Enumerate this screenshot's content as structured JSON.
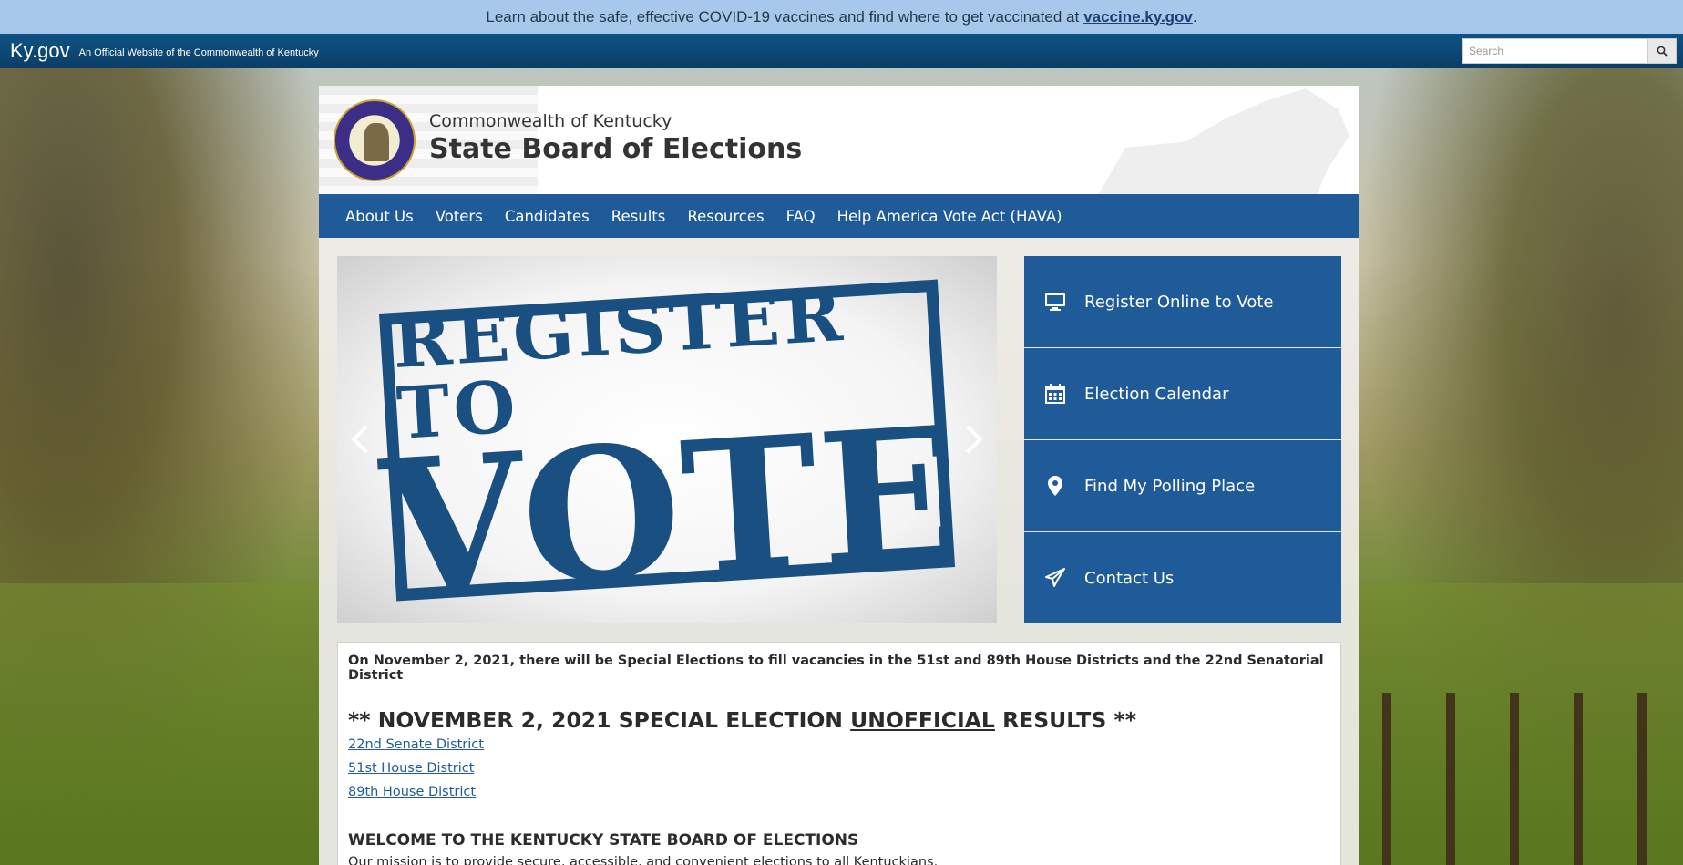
{
  "covid_banner": {
    "text": "Learn about the safe, effective COVID-19 vaccines and find where to get vaccinated at",
    "link": "vaccine.ky.gov",
    "end": "."
  },
  "kygov_bar": {
    "logo": "Ky.gov",
    "tagline": "An Official Website of the Commonwealth of Kentucky",
    "search_placeholder": "Search",
    "search_icon": "search-icon"
  },
  "header": {
    "subtitle": "Commonwealth of Kentucky",
    "title": "State Board of Elections"
  },
  "nav": {
    "items": [
      {
        "label": "About Us"
      },
      {
        "label": "Voters"
      },
      {
        "label": "Candidates"
      },
      {
        "label": "Results"
      },
      {
        "label": "Resources"
      },
      {
        "label": "FAQ"
      },
      {
        "label": "Help America Vote Act (HAVA)"
      }
    ]
  },
  "carousel": {
    "line1": "REGISTER TO",
    "line2": "VOTE"
  },
  "quick_links": [
    {
      "label": "Register Online to Vote",
      "icon": "monitor-icon"
    },
    {
      "label": "Election Calendar",
      "icon": "calendar-icon"
    },
    {
      "label": "Find My Polling Place",
      "icon": "map-pin-icon"
    },
    {
      "label": "Contact Us",
      "icon": "paper-plane-icon"
    }
  ],
  "main": {
    "announcement": "On November 2, 2021, there will be Special Elections to fill vacancies in the 51st and 89th House Districts and the 22nd Senatorial District",
    "results_heading_pre": "** NOVEMBER 2, 2021 SPECIAL ELECTION ",
    "results_heading_underlined": "UNOFFICIAL",
    "results_heading_post": " RESULTS **",
    "result_links": [
      {
        "label": "22nd Senate District"
      },
      {
        "label": "51st House District"
      },
      {
        "label": "89th House District"
      }
    ],
    "welcome_heading": "WELCOME TO THE KENTUCKY STATE BOARD OF ELECTIONS",
    "mission": "Our mission is to provide secure, accessible, and convenient elections to all Kentuckians."
  },
  "colors": {
    "brand_blue": "#1f5b99",
    "banner": "#a7c8ea",
    "kygov_bar": "#0f5384"
  }
}
